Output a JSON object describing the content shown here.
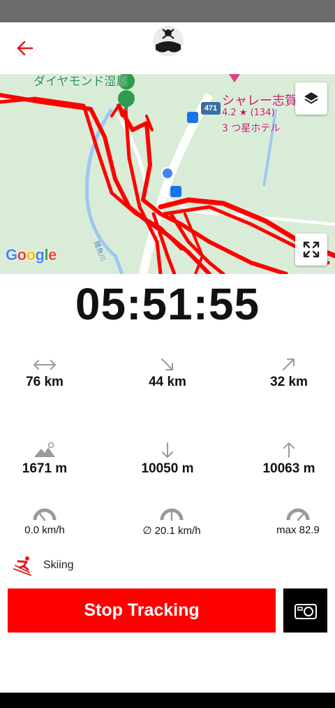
{
  "timer": "05:51:55",
  "stats": [
    {
      "icon": "distance-icon",
      "value": "76 km"
    },
    {
      "icon": "downhill-distance-icon",
      "value": "44 km"
    },
    {
      "icon": "uphill-distance-icon",
      "value": "32 km"
    },
    {
      "icon": "altitude-icon",
      "value": "1671 m"
    },
    {
      "icon": "descent-icon",
      "value": "10050 m"
    },
    {
      "icon": "ascent-icon",
      "value": "10063 m"
    },
    {
      "icon": "speedometer-icon",
      "value": "0.0 km/h"
    },
    {
      "icon": "average-speed-icon",
      "value": "∅ 20.1 km/h"
    },
    {
      "icon": "max-speed-icon",
      "value": "max 82.9"
    }
  ],
  "activity": {
    "icon": "skier-icon",
    "label": "Skiing"
  },
  "buttons": {
    "stop_tracking": "Stop Tracking"
  },
  "map": {
    "attribution": "Google",
    "labels": {
      "area": "ダイヤモンド湿原",
      "hotel_name": "シャレー志賀",
      "hotel_rating": "4.2 ★ (134)",
      "hotel_type": "3 つ星ホテル",
      "road_number": "471",
      "river": "雑魚川"
    }
  },
  "colors": {
    "accent": "#ff0000",
    "track": "#ff0000",
    "map_bg": "#d9ecd7"
  }
}
